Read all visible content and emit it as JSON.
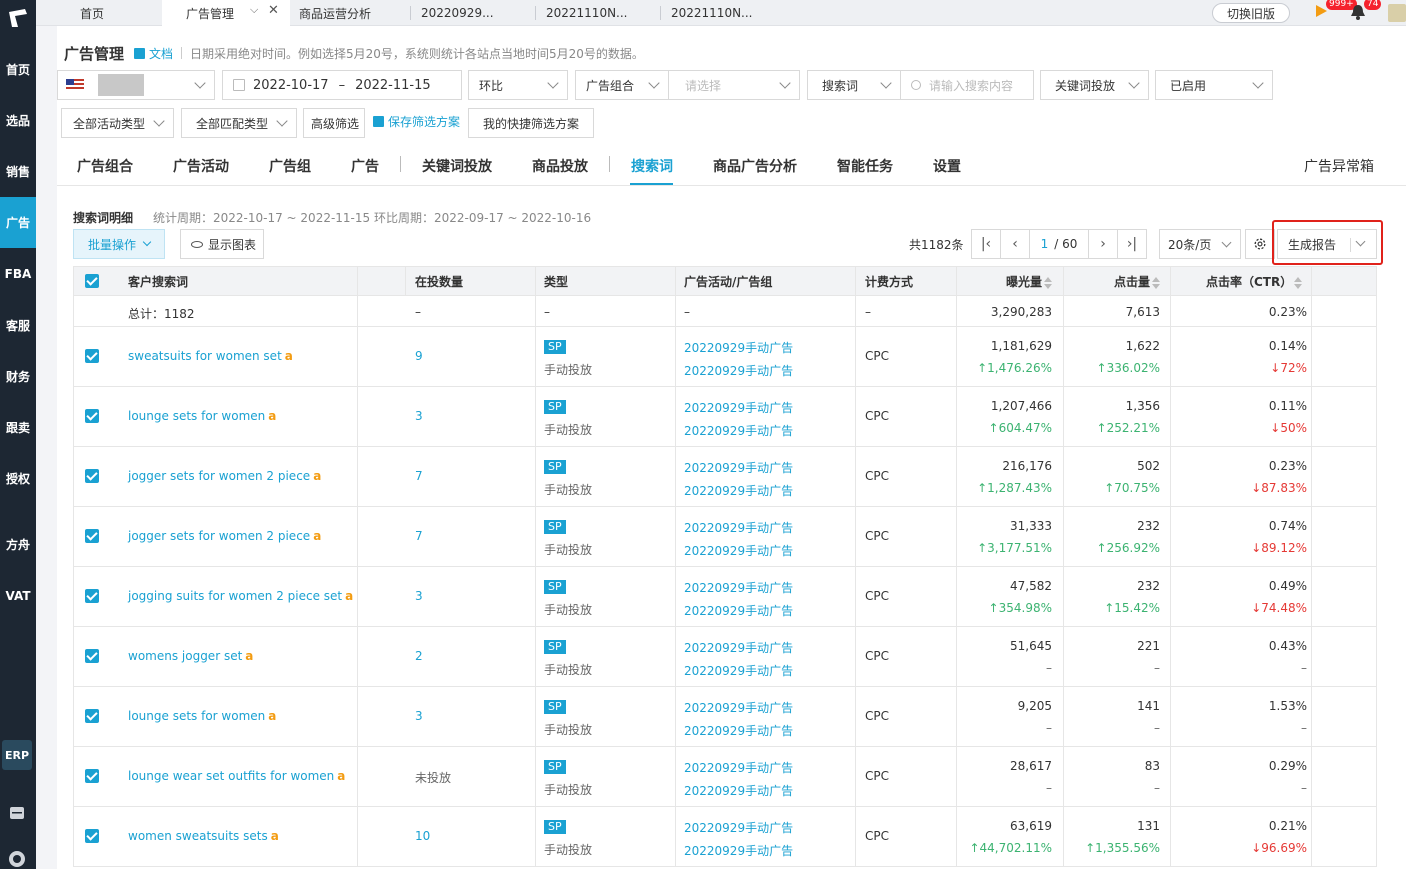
{
  "nav": {
    "items": [
      {
        "label": "首页",
        "active": false
      },
      {
        "label": "选品",
        "active": false
      },
      {
        "label": "销售",
        "active": false
      },
      {
        "label": "广告",
        "active": true
      },
      {
        "label": "FBA",
        "active": false
      },
      {
        "label": "客服",
        "active": false
      },
      {
        "label": "财务",
        "active": false
      },
      {
        "label": "跟卖",
        "active": false
      },
      {
        "label": "授权",
        "active": false
      },
      {
        "label": "方舟",
        "active": false
      },
      {
        "label": "VAT",
        "active": false
      }
    ],
    "erp_label": "ERP"
  },
  "tabs": [
    {
      "label": "首页"
    },
    {
      "label": "广告管理",
      "active": true
    },
    {
      "label": "商品运营分析"
    },
    {
      "label": "20220929..."
    },
    {
      "label": "20221110N..."
    },
    {
      "label": "20221110N..."
    }
  ],
  "topbar": {
    "old_version": "切换旧版",
    "badge_left": "999+",
    "badge_right": "74"
  },
  "header": {
    "title": "广告管理",
    "doc": "文档",
    "note": "日期采用绝对时间。例如选择5月20号，系统则统计各站点当地时间5月20号的数据。"
  },
  "filters": {
    "date_start": "2022-10-17",
    "date_sep": "–",
    "date_end": "2022-11-15",
    "compare": "环比",
    "group_select": "广告组合",
    "group_placeholder": "请选择",
    "search_type": "搜索词",
    "search_placeholder": "请输入搜索内容",
    "keyword_target": "关键词投放",
    "status": "已启用",
    "activity_type": "全部活动类型",
    "match_type": "全部匹配类型",
    "advanced": "高级筛选",
    "save_filter": "保存筛选方案",
    "my_filters": "我的快捷筛选方案"
  },
  "module_tabs": [
    "广告组合",
    "广告活动",
    "广告组",
    "广告",
    "关键词投放",
    "商品投放",
    "搜索词",
    "商品广告分析",
    "智能任务",
    "设置"
  ],
  "module_active": "搜索词",
  "anomaly": "广告异常箱",
  "section": {
    "title": "搜索词明细",
    "period": "统计周期：2022-10-17 ~ 2022-11-15 环比周期：2022-09-17 ~ 2022-10-16",
    "bulk": "批量操作",
    "show_chart": "显示图表",
    "total": "共1182条",
    "page_current": "1",
    "page_total": "/ 60",
    "per_page": "20条/页",
    "report": "生成报告"
  },
  "table": {
    "headers": [
      "客户搜索词",
      "在投数量",
      "类型",
      "广告活动/广告组",
      "计费方式",
      "曝光量",
      "点击量",
      "点击率（CTR）"
    ],
    "total_row": {
      "label": "总计：1182",
      "count": "–",
      "type": "–",
      "campaign": "–",
      "billing": "–",
      "impressions": "3,290,283",
      "clicks": "7,613",
      "ctr": "0.23%"
    },
    "rows": [
      {
        "term": "sweatsuits for women set",
        "count": "9",
        "tag": "SP",
        "type": "手动投放",
        "campaign": "20220929手动广告",
        "group": "20220929手动广告",
        "billing": "CPC",
        "imp": "1,181,629",
        "imp_chg": "↑1,476.26%",
        "imp_dir": "up",
        "clk": "1,622",
        "clk_chg": "↑336.02%",
        "clk_dir": "up",
        "ctr": "0.14%",
        "ctr_chg": "↓72%",
        "ctr_dir": "down"
      },
      {
        "term": "lounge sets for women",
        "count": "3",
        "tag": "SP",
        "type": "手动投放",
        "campaign": "20220929手动广告",
        "group": "20220929手动广告",
        "billing": "CPC",
        "imp": "1,207,466",
        "imp_chg": "↑604.47%",
        "imp_dir": "up",
        "clk": "1,356",
        "clk_chg": "↑252.21%",
        "clk_dir": "up",
        "ctr": "0.11%",
        "ctr_chg": "↓50%",
        "ctr_dir": "down"
      },
      {
        "term": "jogger sets for women 2 piece",
        "count": "7",
        "tag": "SP",
        "type": "手动投放",
        "campaign": "20220929手动广告",
        "group": "20220929手动广告",
        "billing": "CPC",
        "imp": "216,176",
        "imp_chg": "↑1,287.43%",
        "imp_dir": "up",
        "clk": "502",
        "clk_chg": "↑70.75%",
        "clk_dir": "up",
        "ctr": "0.23%",
        "ctr_chg": "↓87.83%",
        "ctr_dir": "down"
      },
      {
        "term": "jogger sets for women 2 piece",
        "count": "7",
        "tag": "SP",
        "type": "手动投放",
        "campaign": "20220929手动广告",
        "group": "20220929手动广告",
        "billing": "CPC",
        "imp": "31,333",
        "imp_chg": "↑3,177.51%",
        "imp_dir": "up",
        "clk": "232",
        "clk_chg": "↑256.92%",
        "clk_dir": "up",
        "ctr": "0.74%",
        "ctr_chg": "↓89.12%",
        "ctr_dir": "down"
      },
      {
        "term": "jogging suits for women 2 piece set",
        "count": "3",
        "tag": "SP",
        "type": "手动投放",
        "campaign": "20220929手动广告",
        "group": "20220929手动广告",
        "billing": "CPC",
        "imp": "47,582",
        "imp_chg": "↑354.98%",
        "imp_dir": "up",
        "clk": "232",
        "clk_chg": "↑15.42%",
        "clk_dir": "up",
        "ctr": "0.49%",
        "ctr_chg": "↓74.48%",
        "ctr_dir": "down"
      },
      {
        "term": "womens jogger set",
        "count": "2",
        "tag": "SP",
        "type": "手动投放",
        "campaign": "20220929手动广告",
        "group": "20220929手动广告",
        "billing": "CPC",
        "imp": "51,645",
        "imp_chg": "–",
        "imp_dir": "none",
        "clk": "221",
        "clk_chg": "–",
        "clk_dir": "none",
        "ctr": "0.43%",
        "ctr_chg": "–",
        "ctr_dir": "none"
      },
      {
        "term": "lounge sets for women",
        "count": "3",
        "tag": "SP",
        "type": "手动投放",
        "campaign": "20220929手动广告",
        "group": "20220929手动广告",
        "billing": "CPC",
        "imp": "9,205",
        "imp_chg": "–",
        "imp_dir": "none",
        "clk": "141",
        "clk_chg": "–",
        "clk_dir": "none",
        "ctr": "1.53%",
        "ctr_chg": "–",
        "ctr_dir": "none"
      },
      {
        "term": "lounge wear set outfits for women",
        "count": "未投放",
        "tag": "SP",
        "type": "手动投放",
        "campaign": "20220929手动广告",
        "group": "20220929手动广告",
        "billing": "CPC",
        "imp": "28,617",
        "imp_chg": "–",
        "imp_dir": "none",
        "clk": "83",
        "clk_chg": "–",
        "clk_dir": "none",
        "ctr": "0.29%",
        "ctr_chg": "–",
        "ctr_dir": "none"
      },
      {
        "term": "women sweatsuits sets",
        "count": "10",
        "tag": "SP",
        "type": "手动投放",
        "campaign": "20220929手动广告",
        "group": "20220929手动广告",
        "billing": "CPC",
        "imp": "63,619",
        "imp_chg": "↑44,702.11%",
        "imp_dir": "up",
        "clk": "131",
        "clk_chg": "↑1,355.56%",
        "clk_dir": "up",
        "ctr": "0.21%",
        "ctr_chg": "↓96.69%",
        "ctr_dir": "down"
      }
    ]
  }
}
